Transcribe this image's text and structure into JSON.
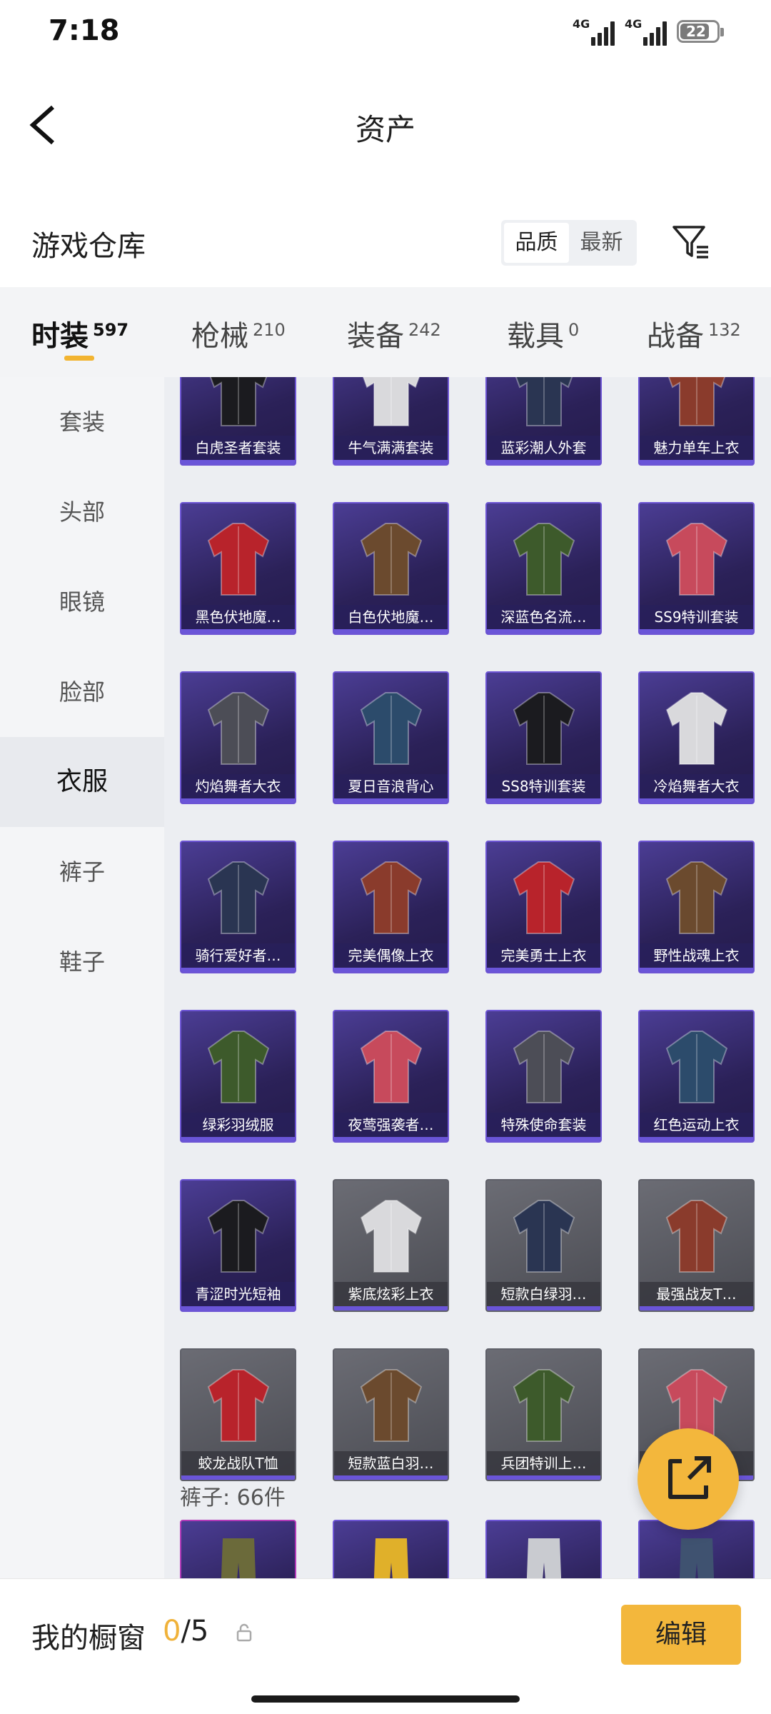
{
  "status_bar": {
    "time": "7:18",
    "network_1": "4G",
    "network_2": "4G",
    "battery_level": "22"
  },
  "header": {
    "title": "资产"
  },
  "section": {
    "title": "游戏仓库",
    "sort_options": [
      "品质",
      "最新"
    ],
    "active_sort": "品质"
  },
  "categories": [
    {
      "name": "时装",
      "count": "597",
      "active": true
    },
    {
      "name": "枪械",
      "count": "210"
    },
    {
      "name": "装备",
      "count": "242"
    },
    {
      "name": "载具",
      "count": "0"
    },
    {
      "name": "战备",
      "count": "132"
    }
  ],
  "sidebar": [
    {
      "label": "套装"
    },
    {
      "label": "头部"
    },
    {
      "label": "眼镜"
    },
    {
      "label": "脸部"
    },
    {
      "label": "衣服",
      "active": true
    },
    {
      "label": "裤子"
    },
    {
      "label": "鞋子"
    }
  ],
  "items": [
    {
      "label": "白虎圣者套装",
      "tier": "purple"
    },
    {
      "label": "牛气满满套装",
      "tier": "purple"
    },
    {
      "label": "蓝彩潮人外套",
      "tier": "purple"
    },
    {
      "label": "魅力单车上衣",
      "tier": "purple"
    },
    {
      "label": "黑色伏地魔…",
      "tier": "purple"
    },
    {
      "label": "白色伏地魔…",
      "tier": "purple"
    },
    {
      "label": "深蓝色名流…",
      "tier": "purple"
    },
    {
      "label": "SS9特训套装",
      "tier": "purple"
    },
    {
      "label": "灼焰舞者大衣",
      "tier": "purple"
    },
    {
      "label": "夏日音浪背心",
      "tier": "purple"
    },
    {
      "label": "SS8特训套装",
      "tier": "purple"
    },
    {
      "label": "冷焰舞者大衣",
      "tier": "purple"
    },
    {
      "label": "骑行爱好者…",
      "tier": "purple"
    },
    {
      "label": "完美偶像上衣",
      "tier": "purple"
    },
    {
      "label": "完美勇士上衣",
      "tier": "purple"
    },
    {
      "label": "野性战魂上衣",
      "tier": "purple"
    },
    {
      "label": "绿彩羽绒服",
      "tier": "purple"
    },
    {
      "label": "夜莺强袭者…",
      "tier": "purple"
    },
    {
      "label": "特殊使命套装",
      "tier": "purple"
    },
    {
      "label": "红色运动上衣",
      "tier": "purple"
    },
    {
      "label": "青涩时光短袖",
      "tier": "purple"
    },
    {
      "label": "紫底炫彩上衣",
      "tier": "gray"
    },
    {
      "label": "短款白绿羽…",
      "tier": "gray"
    },
    {
      "label": "最强战友T…",
      "tier": "gray"
    },
    {
      "label": "蛟龙战队T恤",
      "tier": "gray"
    },
    {
      "label": "短款蓝白羽…",
      "tier": "gray"
    },
    {
      "label": "兵团特训上…",
      "tier": "gray"
    },
    {
      "label": "…",
      "tier": "gray"
    }
  ],
  "pants_section": {
    "header": "裤子: 66件"
  },
  "pants_preview": [
    {
      "tier": "magenta"
    },
    {
      "tier": "purple"
    },
    {
      "tier": "purple"
    },
    {
      "tier": "purple"
    }
  ],
  "bottom_bar": {
    "label": "我的橱窗",
    "used": "0",
    "total": "/5",
    "edit_label": "编辑"
  },
  "colors": {
    "accent": "#f3b73c",
    "purple_card": "#3a2d78",
    "gray_card": "#55565d"
  },
  "icons": {
    "back": "chevron-left-icon",
    "filter": "filter-icon",
    "share": "external-link-icon",
    "lock": "lock-icon"
  }
}
